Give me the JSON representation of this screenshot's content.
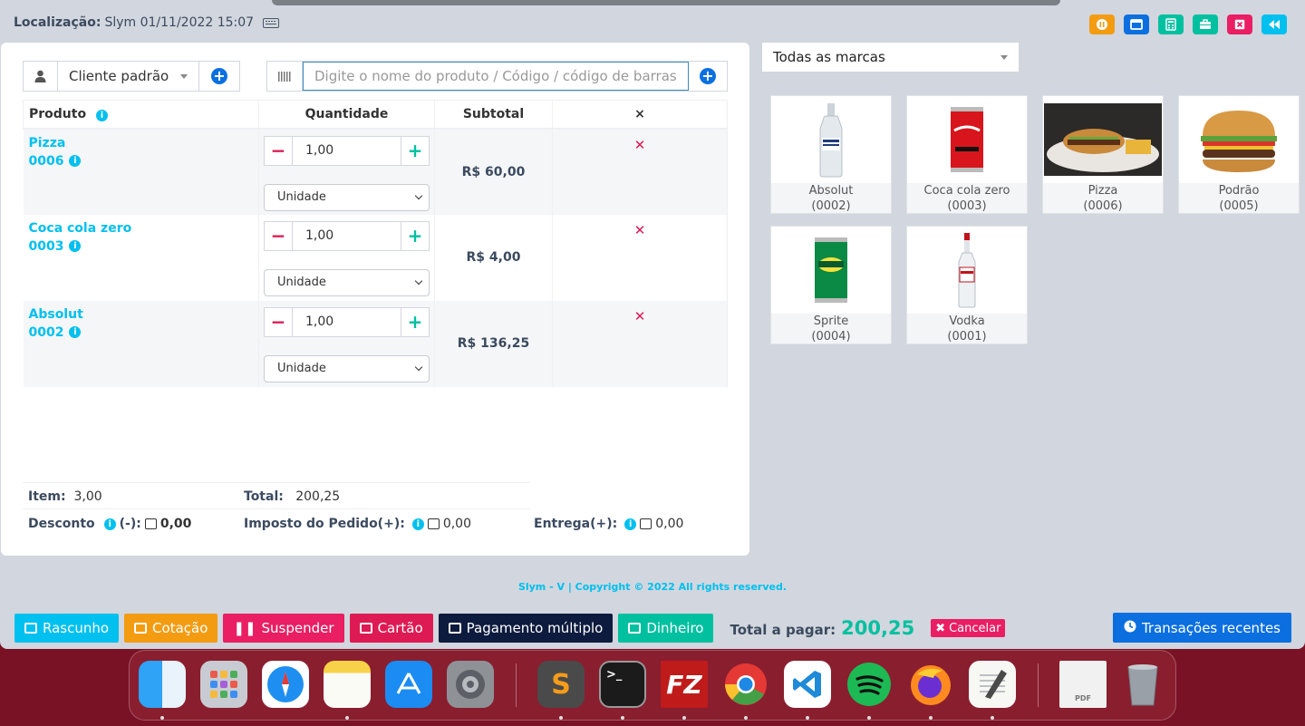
{
  "header": {
    "location_label": "Localização:",
    "location_value": "Slym 01/11/2022 15:07"
  },
  "toolbar_icons": [
    "pause-icon",
    "window-icon",
    "calculator-icon",
    "briefcase-icon",
    "close-register-icon",
    "fast-backward-icon"
  ],
  "customer": {
    "selected": "Cliente padrão"
  },
  "search": {
    "placeholder": "Digite o nome do produto / Código / código de barras"
  },
  "cart": {
    "headers": {
      "product": "Produto",
      "quantity": "Quantidade",
      "subtotal": "Subtotal",
      "remove": "×"
    },
    "rows": [
      {
        "name": "Pizza",
        "code": "0006",
        "qty": "1,00",
        "unit": "Unidade",
        "subtotal": "R$ 60,00"
      },
      {
        "name": "Coca cola zero",
        "code": "0003",
        "qty": "1,00",
        "unit": "Unidade",
        "subtotal": "R$ 4,00"
      },
      {
        "name": "Absolut",
        "code": "0002",
        "qty": "1,00",
        "unit": "Unidade",
        "subtotal": "R$ 136,25"
      }
    ]
  },
  "summary": {
    "items_label": "Item:",
    "items_value": "3,00",
    "total_label": "Total:",
    "total_value": "200,25",
    "discount_label": "Desconto",
    "discount_suffix": "(-):",
    "discount_value": "0,00",
    "tax_label": "Imposto do Pedido(+):",
    "tax_value": "0,00",
    "shipping_label": "Entrega(+):",
    "shipping_value": "0,00"
  },
  "brand_filter": {
    "selected": "Todas as marcas"
  },
  "products": [
    {
      "name": "Absolut",
      "code": "(0002)"
    },
    {
      "name": "Coca cola zero",
      "code": "(0003)"
    },
    {
      "name": "Pizza",
      "code": "(0006)"
    },
    {
      "name": "Podrão",
      "code": "(0005)"
    },
    {
      "name": "Sprite",
      "code": "(0004)"
    },
    {
      "name": "Vodka",
      "code": "(0001)"
    }
  ],
  "footer": {
    "copyright": "Slym - V | Copyright © 2022 All rights reserved."
  },
  "actions": {
    "draft": "Rascunho",
    "quote": "Cotação",
    "suspend": "Suspender",
    "card": "Cartão",
    "multi_payment": "Pagamento múltiplo",
    "cash": "Dinheiro",
    "total_label": "Total a pagar:",
    "total_value": "200,25",
    "cancel": "Cancelar",
    "recent": "Transações recentes"
  },
  "colors": {
    "accent_cyan": "#00c0ef",
    "accent_green": "#00c0a0",
    "danger": "#dd1a53",
    "primary": "#0b6fe0",
    "brand_bg": "#d2d6de"
  },
  "dock_apps": [
    "finder-icon",
    "launchpad-icon",
    "safari-icon",
    "notes-icon",
    "app-store-icon",
    "system-preferences-icon",
    "sublime-text-icon",
    "terminal-icon",
    "filezilla-icon",
    "chrome-icon",
    "vscode-icon",
    "spotify-icon",
    "firefox-icon",
    "textedit-icon",
    "pdf-document-icon",
    "trash-icon"
  ]
}
